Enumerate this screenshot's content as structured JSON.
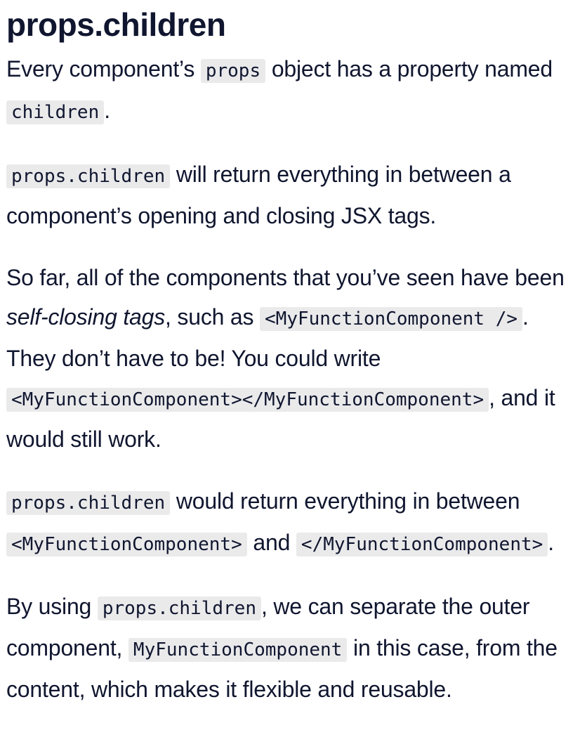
{
  "heading": "props.children",
  "p1": {
    "t1": "Every component’s ",
    "c1": "props",
    "t2": " object has a property named ",
    "c2": "children",
    "t3": "."
  },
  "p2": {
    "c1": "props.children",
    "t1": " will return everything in between a component’s opening and closing JSX tags."
  },
  "p3": {
    "t1": "So far, all of the components that you’ve seen have been ",
    "em": "self-closing tags",
    "t2": ", such as ",
    "c1": "<MyFunctionComponent />",
    "t3": ". They don’t have to be! You could write ",
    "c2": "<MyFunctionComponent></MyFunctionComponent>",
    "t4": ", and it would still work."
  },
  "p4": {
    "c1": "props.children",
    "t1": " would return everything in between ",
    "c2": "<MyFunctionComponent>",
    "t2": " and ",
    "c3": "</MyFunctionComponent>",
    "t3": "."
  },
  "p5": {
    "t1": "By using ",
    "c1": "props.children",
    "t2": ", we can separate the outer component, ",
    "c2": "MyFunctionComponent",
    "t3": " in this case, from the content, which makes it flexible and reusable."
  }
}
